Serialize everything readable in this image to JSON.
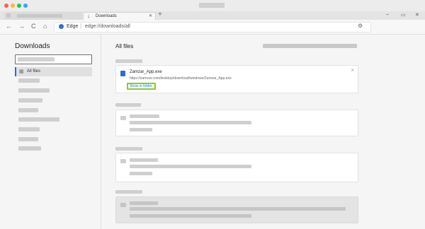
{
  "window": {
    "traffic": [
      "#ff5f57",
      "#febc2e",
      "#28c840",
      "#2fa5ff"
    ]
  },
  "tabs": {
    "active_label": "Downloads",
    "new_tab": "+"
  },
  "window_controls": {
    "min": "–",
    "max": "▭",
    "close": "✕"
  },
  "toolbar": {
    "back": "←",
    "forward": "→",
    "reload": "C",
    "home": "⌂",
    "site_label": "Edge",
    "url": "edge://downloads/all"
  },
  "sidebar": {
    "title": "Downloads",
    "search_placeholder": "",
    "selected_item": "All files"
  },
  "main": {
    "title": "All files",
    "download": {
      "filename": "Zamzar_App.exe",
      "url": "https://zamzar.com/desktop/download/windows/Zamzar_App.exe",
      "show_in_folder": "Show in folder",
      "close": "×"
    }
  },
  "colors": {
    "highlight": "#7ed321",
    "link": "#1a73e8",
    "placeholder": "#cfcfcf"
  }
}
